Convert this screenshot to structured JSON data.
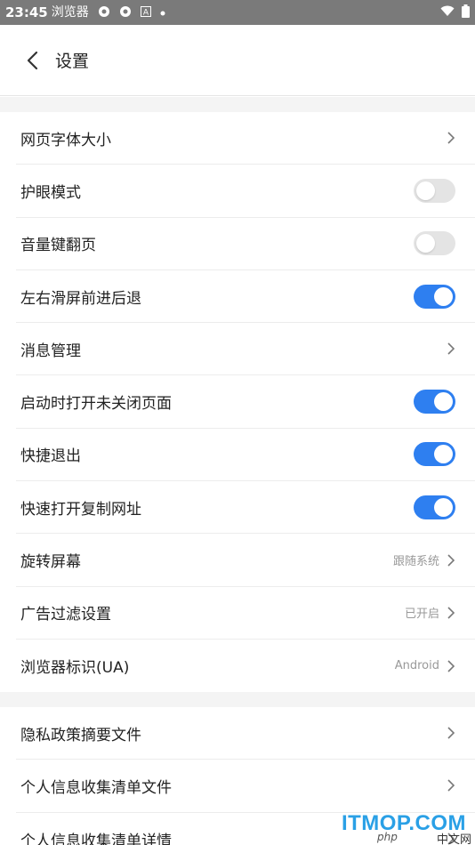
{
  "status_bar": {
    "time": "23:45",
    "app_name": "浏览器",
    "icons": [
      "aperture-icon",
      "aperture-icon",
      "a-box-icon",
      "dot-icon"
    ],
    "right_icons": [
      "wifi-icon",
      "battery-icon"
    ]
  },
  "header": {
    "title": "设置",
    "back_icon": "chevron-left-icon"
  },
  "section1": [
    {
      "label": "网页字体大小",
      "control": "chevron"
    },
    {
      "label": "护眼模式",
      "control": "toggle",
      "state": "off"
    },
    {
      "label": "音量键翻页",
      "control": "toggle",
      "state": "off"
    },
    {
      "label": "左右滑屏前进后退",
      "control": "toggle",
      "state": "on"
    },
    {
      "label": "消息管理",
      "control": "chevron"
    },
    {
      "label": "启动时打开未关闭页面",
      "control": "toggle",
      "state": "on"
    },
    {
      "label": "快捷退出",
      "control": "toggle",
      "state": "on"
    },
    {
      "label": "快速打开复制网址",
      "control": "toggle",
      "state": "on"
    },
    {
      "label": "旋转屏幕",
      "control": "chevron",
      "value": "跟随系统"
    },
    {
      "label": "广告过滤设置",
      "control": "chevron",
      "value": "已开启"
    },
    {
      "label": "浏览器标识(UA)",
      "control": "chevron",
      "value": "Android"
    }
  ],
  "section2": [
    {
      "label": "隐私政策摘要文件",
      "control": "chevron"
    },
    {
      "label": "个人信息收集清单文件",
      "control": "chevron"
    },
    {
      "label": "个人信息收集清单详情",
      "control": "chevron"
    }
  ],
  "watermark": {
    "main": "ITMOP.COM",
    "sub": "中文网",
    "prefix": "php"
  },
  "colors": {
    "toggle_on": "#2e7ff0",
    "toggle_off": "#e4e4e4",
    "section_gap": "#f4f4f4",
    "status_bar": "#7a7a7a"
  }
}
